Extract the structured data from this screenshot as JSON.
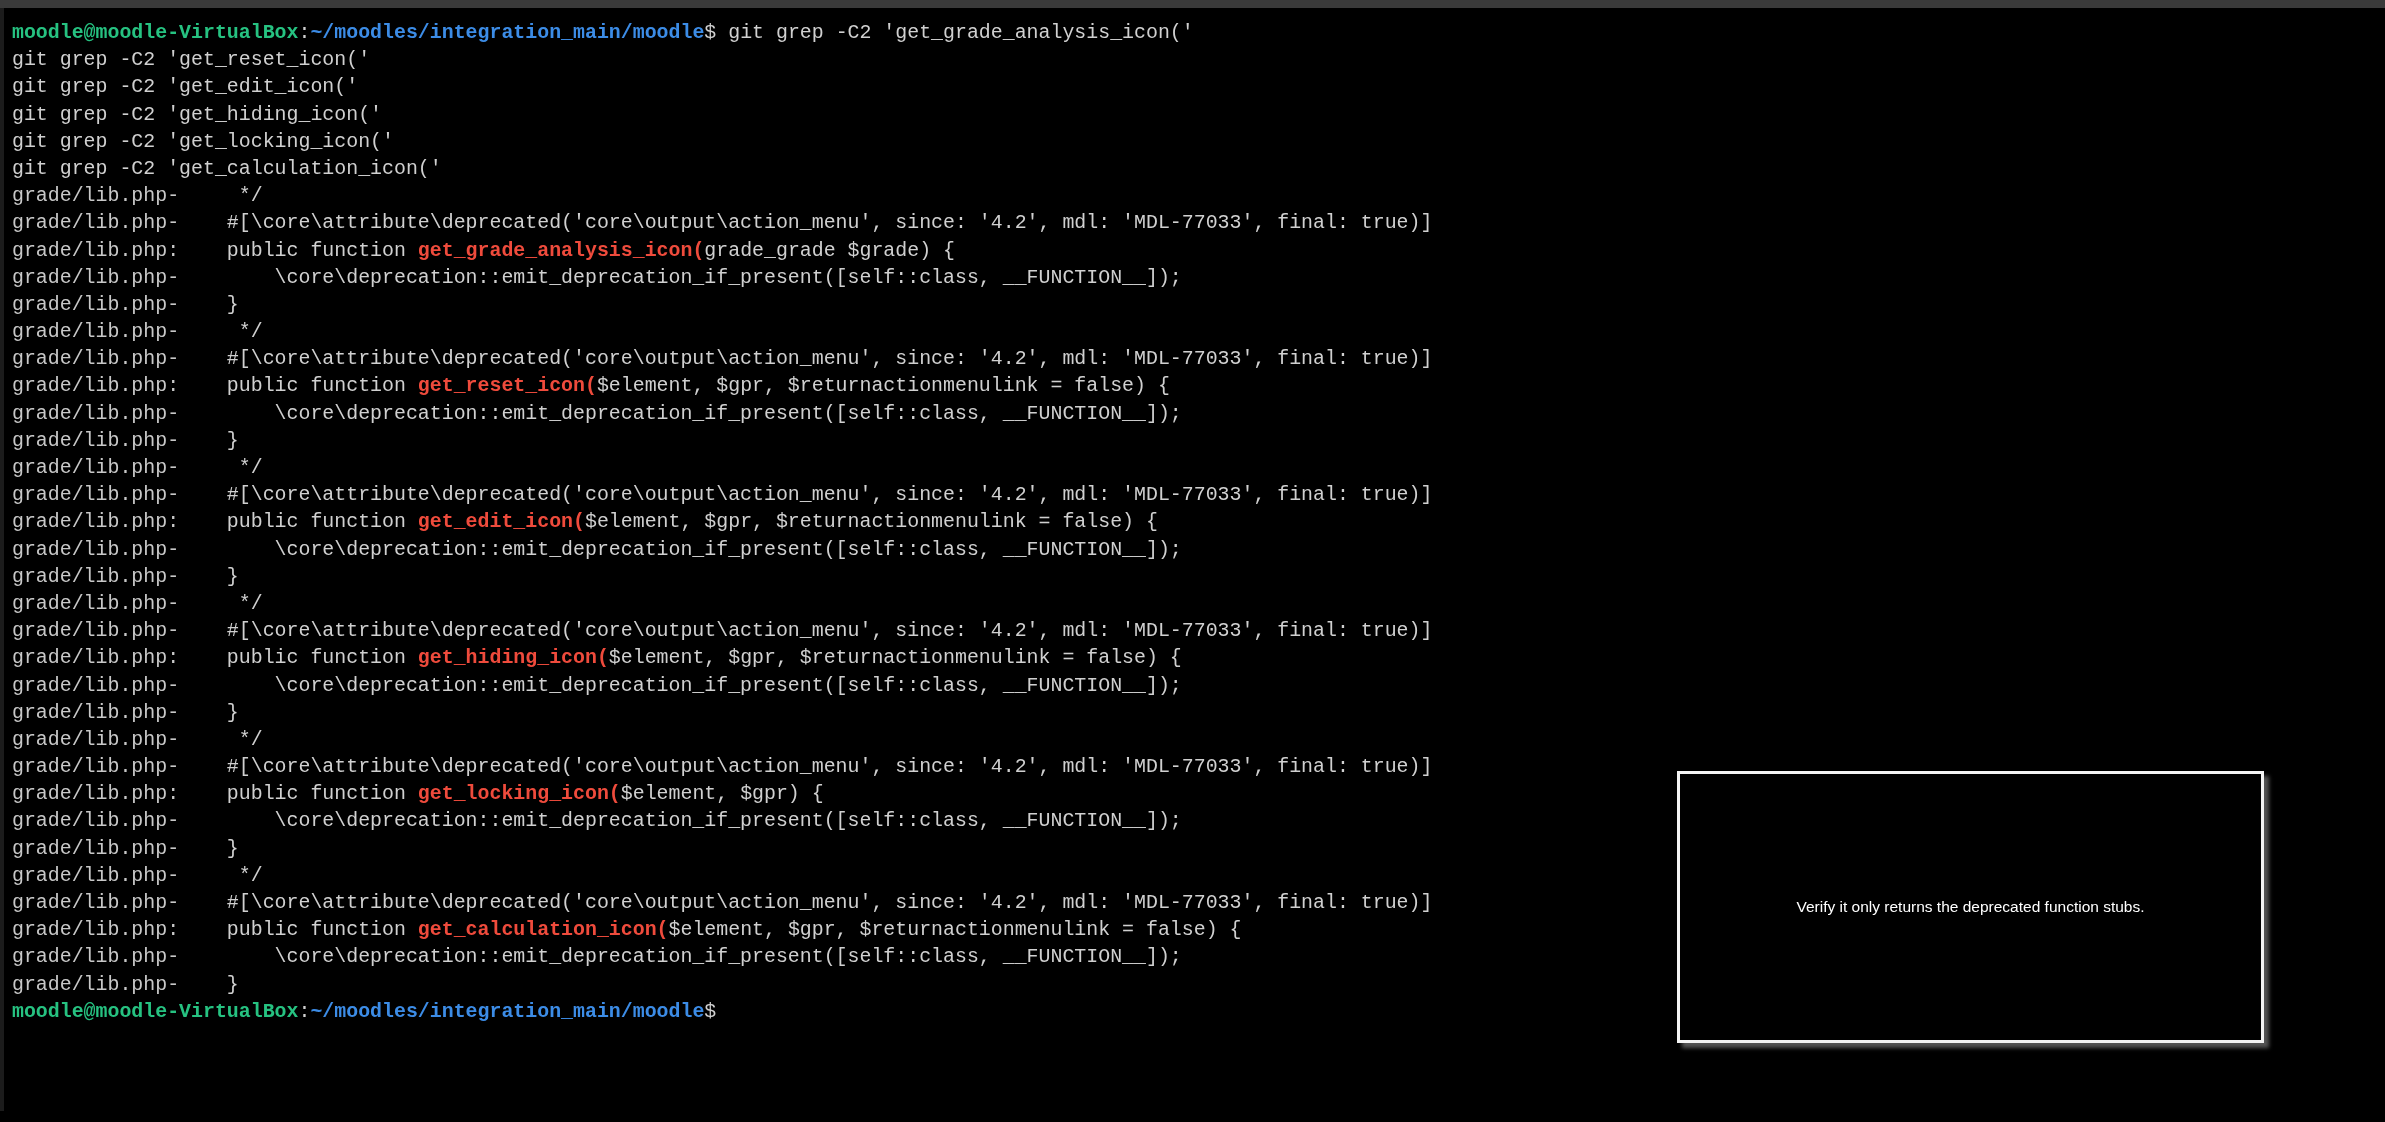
{
  "terminal": {
    "lines": [
      {
        "kind": "prompt",
        "user": "moodle@moodle-VirtualBox",
        "sep": ":",
        "path": "~/moodles/integration_main/moodle",
        "symbol": "$",
        "command": " git grep -C2 'get_grade_analysis_icon('"
      },
      {
        "kind": "plain",
        "text": "git grep -C2 'get_reset_icon('"
      },
      {
        "kind": "plain",
        "text": "git grep -C2 'get_edit_icon('"
      },
      {
        "kind": "plain",
        "text": "git grep -C2 'get_hiding_icon('"
      },
      {
        "kind": "plain",
        "text": "git grep -C2 'get_locking_icon('"
      },
      {
        "kind": "plain",
        "text": "git grep -C2 'get_calculation_icon('"
      },
      {
        "kind": "context",
        "file": "grade/lib.php-",
        "text": "     */"
      },
      {
        "kind": "context",
        "file": "grade/lib.php-",
        "text": "    #[\\core\\attribute\\deprecated('core\\output\\action_menu', since: '4.2', mdl: 'MDL-77033', final: true)]"
      },
      {
        "kind": "match",
        "file": "grade/lib.php:",
        "before": "    public function ",
        "match": "get_grade_analysis_icon(",
        "after": "grade_grade $grade) {"
      },
      {
        "kind": "context",
        "file": "grade/lib.php-",
        "text": "        \\core\\deprecation::emit_deprecation_if_present([self::class, __FUNCTION__]);"
      },
      {
        "kind": "context",
        "file": "grade/lib.php-",
        "text": "    }"
      },
      {
        "kind": "context",
        "file": "grade/lib.php-",
        "text": "     */"
      },
      {
        "kind": "context",
        "file": "grade/lib.php-",
        "text": "    #[\\core\\attribute\\deprecated('core\\output\\action_menu', since: '4.2', mdl: 'MDL-77033', final: true)]"
      },
      {
        "kind": "match",
        "file": "grade/lib.php:",
        "before": "    public function ",
        "match": "get_reset_icon(",
        "after": "$element, $gpr, $returnactionmenulink = false) {"
      },
      {
        "kind": "context",
        "file": "grade/lib.php-",
        "text": "        \\core\\deprecation::emit_deprecation_if_present([self::class, __FUNCTION__]);"
      },
      {
        "kind": "context",
        "file": "grade/lib.php-",
        "text": "    }"
      },
      {
        "kind": "context",
        "file": "grade/lib.php-",
        "text": "     */"
      },
      {
        "kind": "context",
        "file": "grade/lib.php-",
        "text": "    #[\\core\\attribute\\deprecated('core\\output\\action_menu', since: '4.2', mdl: 'MDL-77033', final: true)]"
      },
      {
        "kind": "match",
        "file": "grade/lib.php:",
        "before": "    public function ",
        "match": "get_edit_icon(",
        "after": "$element, $gpr, $returnactionmenulink = false) {"
      },
      {
        "kind": "context",
        "file": "grade/lib.php-",
        "text": "        \\core\\deprecation::emit_deprecation_if_present([self::class, __FUNCTION__]);"
      },
      {
        "kind": "context",
        "file": "grade/lib.php-",
        "text": "    }"
      },
      {
        "kind": "context",
        "file": "grade/lib.php-",
        "text": "     */"
      },
      {
        "kind": "context",
        "file": "grade/lib.php-",
        "text": "    #[\\core\\attribute\\deprecated('core\\output\\action_menu', since: '4.2', mdl: 'MDL-77033', final: true)]"
      },
      {
        "kind": "match",
        "file": "grade/lib.php:",
        "before": "    public function ",
        "match": "get_hiding_icon(",
        "after": "$element, $gpr, $returnactionmenulink = false) {"
      },
      {
        "kind": "context",
        "file": "grade/lib.php-",
        "text": "        \\core\\deprecation::emit_deprecation_if_present([self::class, __FUNCTION__]);"
      },
      {
        "kind": "context",
        "file": "grade/lib.php-",
        "text": "    }"
      },
      {
        "kind": "context",
        "file": "grade/lib.php-",
        "text": "     */"
      },
      {
        "kind": "context",
        "file": "grade/lib.php-",
        "text": "    #[\\core\\attribute\\deprecated('core\\output\\action_menu', since: '4.2', mdl: 'MDL-77033', final: true)]"
      },
      {
        "kind": "match",
        "file": "grade/lib.php:",
        "before": "    public function ",
        "match": "get_locking_icon(",
        "after": "$element, $gpr) {"
      },
      {
        "kind": "context",
        "file": "grade/lib.php-",
        "text": "        \\core\\deprecation::emit_deprecation_if_present([self::class, __FUNCTION__]);"
      },
      {
        "kind": "context",
        "file": "grade/lib.php-",
        "text": "    }"
      },
      {
        "kind": "context",
        "file": "grade/lib.php-",
        "text": "     */"
      },
      {
        "kind": "context",
        "file": "grade/lib.php-",
        "text": "    #[\\core\\attribute\\deprecated('core\\output\\action_menu', since: '4.2', mdl: 'MDL-77033', final: true)]"
      },
      {
        "kind": "match",
        "file": "grade/lib.php:",
        "before": "    public function ",
        "match": "get_calculation_icon(",
        "after": "$element, $gpr, $returnactionmenulink = false) {"
      },
      {
        "kind": "context",
        "file": "grade/lib.php-",
        "text": "        \\core\\deprecation::emit_deprecation_if_present([self::class, __FUNCTION__]);"
      },
      {
        "kind": "context",
        "file": "grade/lib.php-",
        "text": "    }"
      },
      {
        "kind": "prompt",
        "user": "moodle@moodle-VirtualBox",
        "sep": ":",
        "path": "~/moodles/integration_main/moodle",
        "symbol": "$"
      }
    ]
  },
  "caption": {
    "text": "Verify it only returns the deprecated function stubs."
  }
}
